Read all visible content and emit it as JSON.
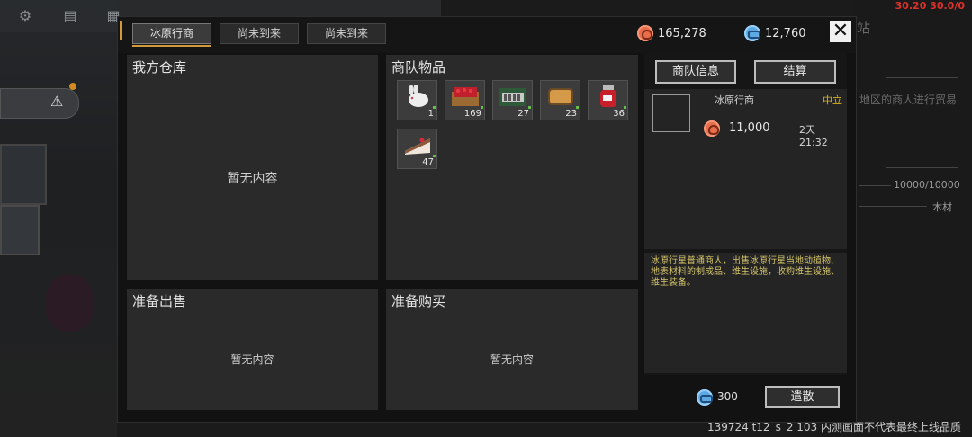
{
  "background": {
    "topbar_value_1": "165,278",
    "topbar_value_2": "12,760",
    "right_text_1": "站",
    "right_text_2": "地区的商人进行贸易",
    "right_text_3": "10000/10000",
    "right_text_4": "木材",
    "debug_top": "30.20 30.0/0",
    "debug_bottom": "139724 t12_s_2 103  内测画面不代表最终上线品质"
  },
  "tabs": [
    {
      "label": "冰原行商",
      "active": true
    },
    {
      "label": "尚未到来",
      "active": false
    },
    {
      "label": "尚未到来",
      "active": false
    }
  ],
  "currency": {
    "red_amount": "165,278",
    "blue_amount": "12,760"
  },
  "panels": {
    "warehouse": {
      "title": "我方仓库",
      "empty": "暂无内容"
    },
    "caravan": {
      "title": "商队物品"
    },
    "sell": {
      "title": "准备出售",
      "empty": "暂无内容"
    },
    "buy": {
      "title": "准备购买",
      "empty": "暂无内容"
    }
  },
  "caravan_items": [
    {
      "icon": "rabbit-icon",
      "count": "1"
    },
    {
      "icon": "berry-crate-icon",
      "count": "169"
    },
    {
      "icon": "machine-crate-icon",
      "count": "27"
    },
    {
      "icon": "bread-icon",
      "count": "23"
    },
    {
      "icon": "jam-jar-icon",
      "count": "36"
    },
    {
      "icon": "cake-slice-icon",
      "count": "47"
    }
  ],
  "info": {
    "tab_info": "商队信息",
    "tab_settle": "结算",
    "merchant_name": "冰原行商",
    "stance": "中立",
    "price": "11,000",
    "time_left": "2天 21:32",
    "description": "冰原行星普通商人，出售冰原行星当地动植物、地表材料的制成品、维生设施，收购维生设施、维生装备。",
    "dismiss_cost": "300",
    "dismiss_label": "遣散"
  },
  "colors": {
    "accent": "#d09a3a",
    "stance_color": "#d4b21a",
    "desc_color": "#d4c56a"
  }
}
